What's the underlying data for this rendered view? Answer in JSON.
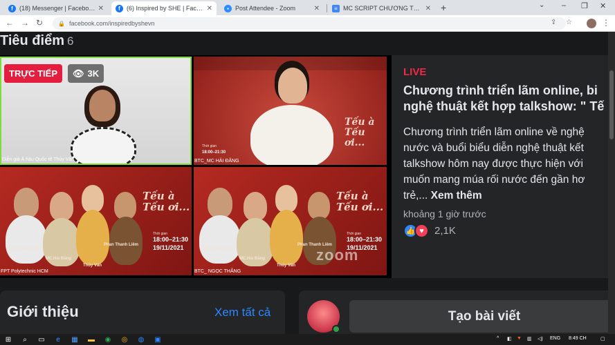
{
  "browser": {
    "tabs": [
      {
        "title": "(18) Messenger | Facebook",
        "active": false,
        "favicon": "facebook-icon"
      },
      {
        "title": "(6) Inspired by SHE | Facebook",
        "active": true,
        "favicon": "facebook-icon"
      },
      {
        "title": "Post Attendee - Zoom",
        "active": false,
        "favicon": "zoom-icon"
      },
      {
        "title": "MC SCRIPT CHƯƠNG TRÌNH TRIỂ",
        "active": false,
        "favicon": "docs-icon"
      }
    ],
    "url": "facebook.com/inspiredbyshevn"
  },
  "section": {
    "title": "Tiêu điểm",
    "count": "6"
  },
  "video": {
    "live_label": "TRỰC TIẾP",
    "viewers": "3K",
    "tiles": [
      {
        "caption": "Diễn giả Á hậu Quốc tế Thúy Vân"
      },
      {
        "caption": "BTC_MC HẢI ĐĂNG",
        "poster_title": "Tếu à Tếu ơi...",
        "time_label": "Thời gian",
        "time": "18:00–21:30"
      },
      {
        "caption": "FPT Polytechnic HCM",
        "poster_title": "Tếu à Tếu ơi...",
        "time_label": "Thời gian",
        "time": "18:00–21:30",
        "date": "19/11/2021",
        "labels": [
          "Huỳnh Anh Tuấn",
          "MC.Hải Đăng",
          "Thúy Vân",
          "Phan Thanh Liêm"
        ]
      },
      {
        "caption": "BTC_ NGỌC THẮNG",
        "poster_title": "Tếu à Tếu ơi...",
        "time_label": "Thời gian",
        "time": "18:00–21:30",
        "date": "19/11/2021",
        "labels": [
          "Huỳnh Anh Tuấn",
          "MC.Hải Đăng",
          "Thúy Vân",
          "Phan Thanh Liêm"
        ]
      }
    ],
    "watermark": "zoom"
  },
  "post": {
    "live": "LIVE",
    "title": "Chương trình triển lãm online, bi\nnghệ thuật kết hợp talkshow: \" Tế",
    "body": "Chương trình triển lãm online về nghệ\nnước và buổi biểu diễn nghệ thuật kết\ntalkshow hôm nay được thực hiện với\nmuốn mang múa rối nước đến gần hơ\ntrẻ,... ",
    "see_more": "Xem thêm",
    "time": "khoảng 1 giờ trước",
    "reaction_count": "2,1K"
  },
  "intro": {
    "title": "Giới thiệu",
    "see_all": "Xem tất cả"
  },
  "create_post": {
    "label": "Tạo bài viết"
  },
  "taskbar": {
    "lang": "ENG",
    "clock": "8:49 CH"
  },
  "colors": {
    "fb_blue": "#2d88ff",
    "live_red": "#e41e3f",
    "zoom_blue": "#2d8cff",
    "bg_dark": "#18191a",
    "card_dark": "#242526"
  }
}
